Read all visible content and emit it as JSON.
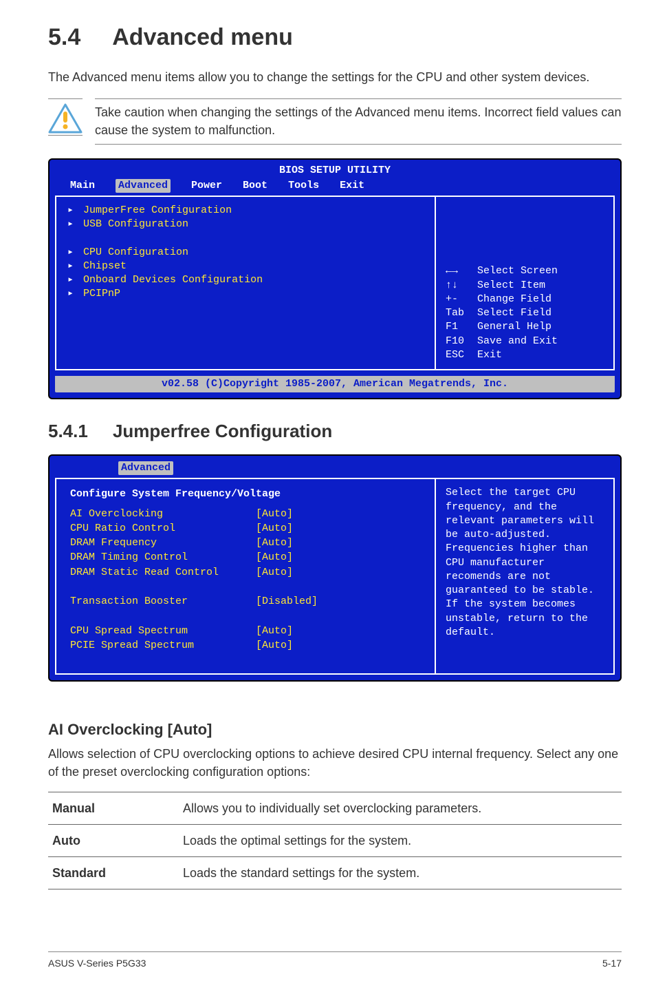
{
  "section": {
    "number": "5.4",
    "title": "Advanced menu",
    "intro": "The Advanced menu items allow you to change the settings for the CPU and other system devices.",
    "caution": "Take caution when changing the settings of the Advanced menu items. Incorrect field values can cause the system to malfunction."
  },
  "bios1": {
    "title": "BIOS SETUP UTILITY",
    "tabs": [
      "Main",
      "Advanced",
      "Power",
      "Boot",
      "Tools",
      "Exit"
    ],
    "selected_tab": "Advanced",
    "group1": [
      "JumperFree Configuration",
      "USB Configuration"
    ],
    "group2": [
      "CPU Configuration",
      "Chipset",
      "Onboard Devices Configuration",
      "PCIPnP"
    ],
    "help_keys": [
      {
        "k": "←→",
        "v": "Select Screen"
      },
      {
        "k": "↑↓",
        "v": "Select Item"
      },
      {
        "k": "+-",
        "v": "Change Field"
      },
      {
        "k": "Tab",
        "v": "Select Field"
      },
      {
        "k": "F1",
        "v": "General Help"
      },
      {
        "k": "F10",
        "v": "Save and Exit"
      },
      {
        "k": "ESC",
        "v": "Exit"
      }
    ],
    "footer": "v02.58 (C)Copyright 1985-2007, American Megatrends, Inc."
  },
  "subsection": {
    "number": "5.4.1",
    "title": "Jumperfree Configuration"
  },
  "bios2": {
    "tab": "Advanced",
    "heading": "Configure System Frequency/Voltage",
    "rows": [
      {
        "label": "AI Overclocking",
        "value": "[Auto]"
      },
      {
        "label": "CPU Ratio Control",
        "value": "[Auto]"
      },
      {
        "label": "DRAM Frequency",
        "value": "[Auto]"
      },
      {
        "label": "DRAM Timing Control",
        "value": "[Auto]"
      },
      {
        "label": "DRAM Static Read Control",
        "value": "[Auto]"
      },
      {
        "label": "",
        "value": ""
      },
      {
        "label": "Transaction Booster",
        "value": "[Disabled]"
      },
      {
        "label": "",
        "value": ""
      },
      {
        "label": "CPU Spread Spectrum",
        "value": "[Auto]"
      },
      {
        "label": "PCIE Spread Spectrum",
        "value": "[Auto]"
      }
    ],
    "help": "Select the target CPU frequency, and the relevant parameters will be auto-adjusted. Frequencies higher than CPU manufacturer recomends are not guaranteed to be stable. If the system becomes unstable, return to the default."
  },
  "ai_over": {
    "heading": "AI Overclocking [Auto]",
    "text": "Allows selection of CPU overclocking options to achieve desired CPU internal frequency. Select any one of the preset overclocking configuration options:"
  },
  "options_table": [
    {
      "name": "Manual",
      "desc": "Allows you to individually set overclocking parameters."
    },
    {
      "name": "Auto",
      "desc": "Loads the optimal settings for the system."
    },
    {
      "name": "Standard",
      "desc": "Loads the standard settings for the system."
    }
  ],
  "footer": {
    "left": "ASUS V-Series P5G33",
    "right": "5-17"
  }
}
